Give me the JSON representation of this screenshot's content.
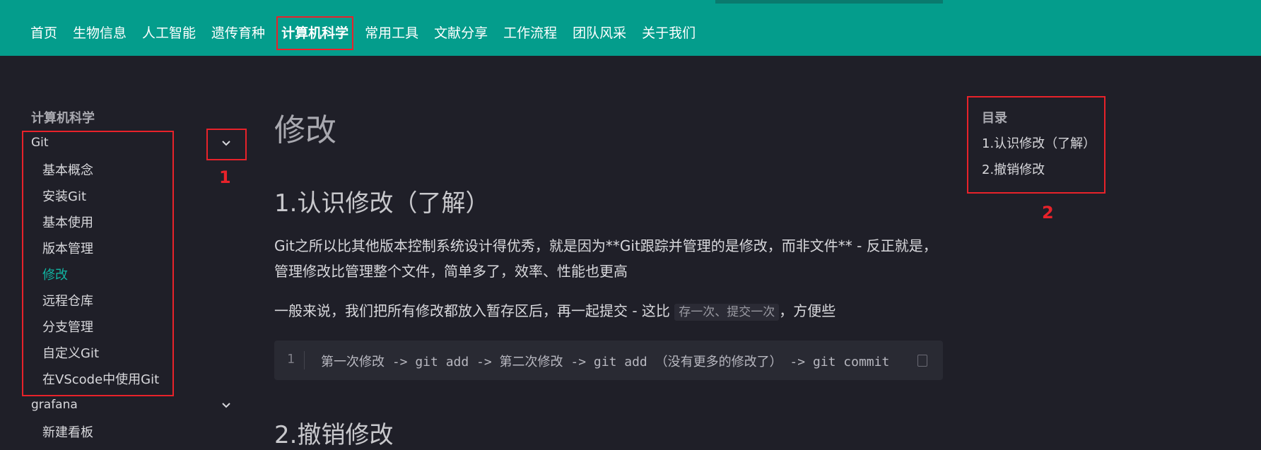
{
  "nav": {
    "items": [
      "首页",
      "生物信息",
      "人工智能",
      "遗传育种",
      "计算机科学",
      "常用工具",
      "文献分享",
      "工作流程",
      "团队风采",
      "关于我们"
    ],
    "active_index": 4
  },
  "sidebar": {
    "title": "计算机科学",
    "group1": "Git",
    "items": [
      "基本概念",
      "安装Git",
      "基本使用",
      "版本管理",
      "修改",
      "远程仓库",
      "分支管理",
      "自定义Git",
      "在VScode中使用Git"
    ],
    "active_item": "修改",
    "group2": "grafana",
    "group2_item": "新建看板"
  },
  "main": {
    "title": "修改",
    "section1": "1.认识修改（了解）",
    "para1": "Git之所以比其他版本控制系统设计得优秀，就是因为**Git跟踪并管理的是修改，而非文件** - 反正就是，管理修改比管理整个文件，简单多了，效率、性能也更高",
    "para2_before": "一般来说，我们把所有修改都放入暂存区后，再一起提交 - 这比 ",
    "para2_code": "存一次、提交一次",
    "para2_after": "，方便些",
    "code_line_no": "1",
    "code": "第一次修改 -> git add -> 第二次修改 -> git add （没有更多的修改了） ->  git commit",
    "section2": "2.撤销修改"
  },
  "toc": {
    "title": "目录",
    "items": [
      "1.认识修改（了解）",
      "2.撤销修改"
    ]
  },
  "annotations": {
    "label1": "1",
    "label2": "2"
  },
  "colors": {
    "nav_bg": "#049d8c",
    "page_bg": "#1f1f28",
    "accent": "#11b3a1",
    "annotation": "#e8222a"
  }
}
